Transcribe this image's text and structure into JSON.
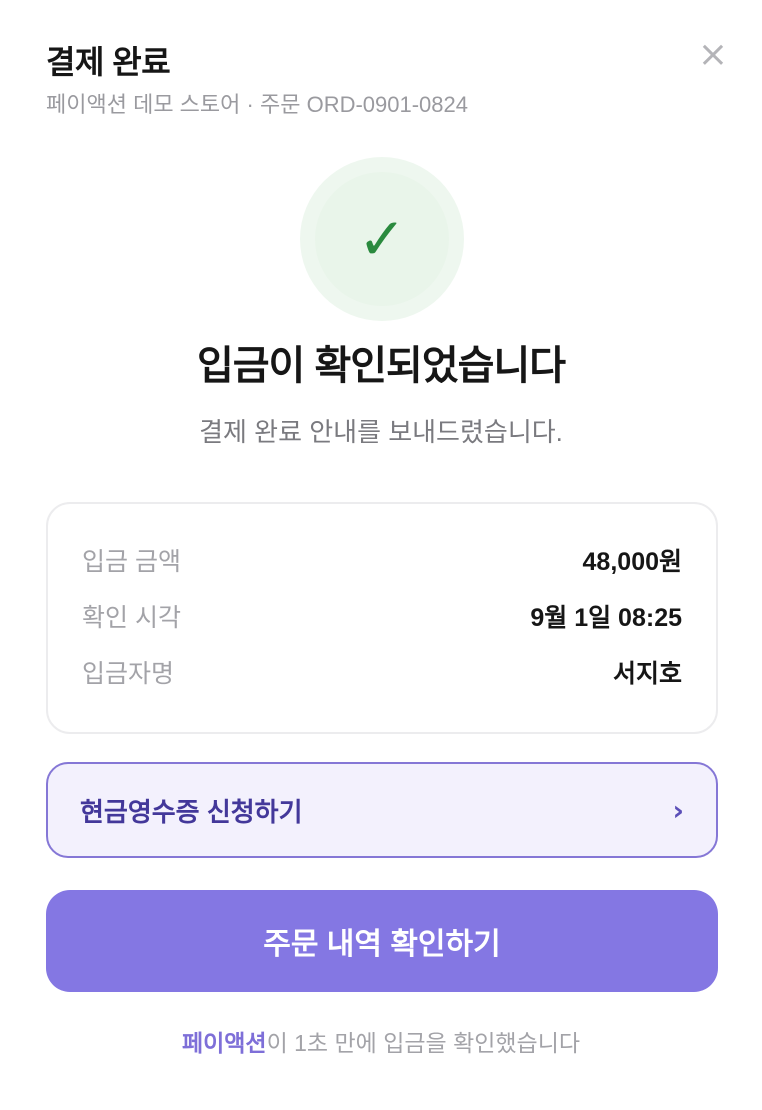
{
  "header": {
    "title": "결제 완료",
    "store": "페이액션 데모 스토어",
    "separator": "·",
    "order_label": "주문",
    "order_id": "ORD-0901-0824",
    "close_symbol": "×"
  },
  "status": {
    "check_symbol": "✓",
    "headline": "입금이 확인되었습니다",
    "description": "결제 완료 안내를 보내드렸습니다."
  },
  "info": {
    "rows": [
      {
        "label": "입금 금액",
        "value": "48,000원"
      },
      {
        "label": "확인 시각",
        "value": "9월 1일 08:25"
      },
      {
        "label": "입금자명",
        "value": "서지호"
      }
    ]
  },
  "receipt": {
    "label": "현금영수증 신청하기",
    "chevron": "›"
  },
  "primary_action": {
    "label": "주문 내역 확인하기"
  },
  "footer": {
    "brand": "페이액션",
    "text": "이 1초 만에 입금을 확인했습니다"
  },
  "colors": {
    "accent": "#8477e3",
    "accent_dark": "#43389a",
    "success": "#2a8a3e",
    "success_bg": "#eef7ef"
  },
  "icons": {
    "close": "close-icon",
    "success": "check-icon",
    "chevron": "chevron-right-icon"
  }
}
